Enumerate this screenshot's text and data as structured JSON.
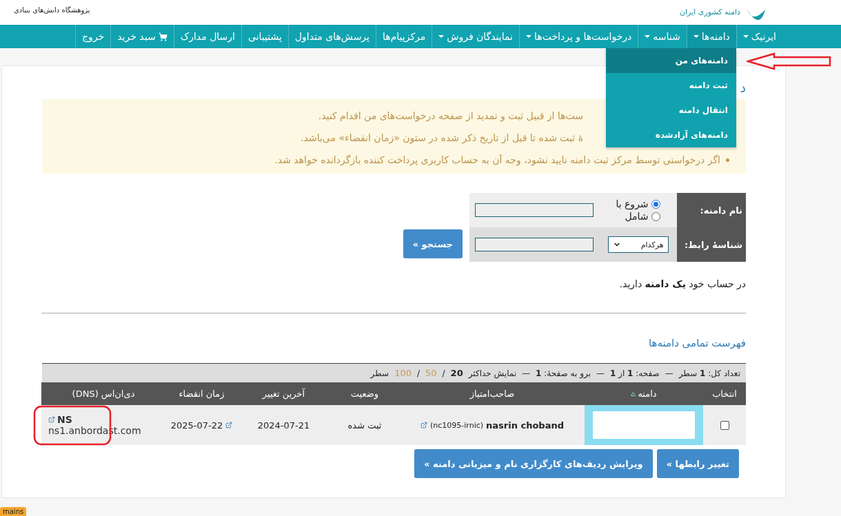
{
  "header": {
    "institute": "پژوهشگاه دانش‌های بنیادی",
    "registry": "دامنه کشوری ایران"
  },
  "nav": {
    "items": [
      {
        "label": "ایرنیک",
        "kind": "link",
        "dropdown": true
      },
      {
        "label": "دامنه‌ها",
        "kind": "link",
        "dropdown": true,
        "menu": [
          {
            "label": "دامنه‌های من",
            "selected": true
          },
          {
            "label": "ثبت دامنه",
            "selected": false
          },
          {
            "label": "انتقال دامنه",
            "selected": false
          },
          {
            "label": "دامنه‌های آزادشده",
            "selected": false
          }
        ]
      },
      {
        "label": "شناسه",
        "kind": "link",
        "dropdown": true
      },
      {
        "label": "درخواست‌ها و پرداخت‌ها",
        "kind": "link",
        "dropdown": true
      },
      {
        "label": "نمایندگان فروش",
        "kind": "link",
        "dropdown": true
      },
      {
        "label": "مرکزپیام‌ها",
        "kind": "link",
        "dropdown": false
      },
      {
        "label": "پرسش‌های متداول",
        "kind": "link",
        "dropdown": false
      },
      {
        "label": "پشتیبانی",
        "kind": "link",
        "dropdown": false
      },
      {
        "label": "ارسال مدارک",
        "kind": "link",
        "dropdown": false
      },
      {
        "label": "سبد خرید",
        "kind": "cart",
        "dropdown": false
      },
      {
        "label": "خروج",
        "kind": "link",
        "dropdown": false
      }
    ]
  },
  "page": {
    "heading": "د",
    "notices": [
      {
        "text": "ست‌ها از قبیل ثبت و تمدید از صفحه درخواست‌های من اقدام کنید.",
        "cut": true
      },
      {
        "text": "ۀ ثبت شده تا قبل از تاریخ ذکر شده در ستون «زمان انقضاء» می‌باشد.",
        "cut": true
      },
      {
        "text": "اگر درخواستی توسط مرکز ثبت دامنه تایید نشود، وجه آن به حساب کاربری پرداخت کننده بازگردانده خواهد شد.",
        "cut": false
      }
    ]
  },
  "search": {
    "fields": [
      {
        "label": "نام دامنه:",
        "kind": "radios",
        "options": [
          {
            "label": "شروع با",
            "selected": true
          },
          {
            "label": "شامل",
            "selected": false
          }
        ]
      },
      {
        "label": "شناسهٔ رابط:",
        "kind": "select",
        "value": "هرکدام"
      }
    ],
    "button": "جستجو »"
  },
  "summary": "در حساب خود **یک دامنه** دارید.",
  "list_title": "فهرست تمامی دامنه‌ها",
  "table": {
    "info": [
      {
        "text": "تعداد کل: **1** سطر",
        "separator": "—"
      },
      {
        "text": "صفحه: **1** از **1**",
        "separator": "—"
      },
      {
        "text": "برو به صفحهٔ: **1**",
        "separator": "—"
      }
    ],
    "page_size": {
      "label": "نمایش حداکثر",
      "options": [
        {
          "label": "20",
          "selected": true,
          "divider": "/"
        },
        {
          "label": "50",
          "selected": false,
          "divider": "/"
        },
        {
          "label": "100",
          "selected": false
        }
      ],
      "unit": "سطر"
    },
    "columns": [
      {
        "label": "انتخاب",
        "sorted": false
      },
      {
        "label": "دامنه",
        "sorted": true
      },
      {
        "label": "صاحب‌امتیاز",
        "sorted": false
      },
      {
        "label": "وضعیت",
        "sorted": false
      },
      {
        "label": "آخرین تغییر",
        "sorted": false
      },
      {
        "label": "زمان انقضاء",
        "sorted": false
      },
      {
        "label": "دی‌ان‌اس (DNS)",
        "sorted": false
      }
    ],
    "rows": [
      {
        "checked": false,
        "owner": "nasrin choband",
        "owner_handle": "(nc1095-irnic)",
        "status": "ثبت شده",
        "updated": "2024-07-21",
        "expires": "2025-07-22",
        "dns_title": "NS",
        "dns_server": "ns1.anbordast.com"
      }
    ]
  },
  "buttons": [
    "تغییر رابطها »",
    "ویرایش ردیف‌های کارگزاری نام و میزبانی دامنه »"
  ],
  "badge": "mains"
}
